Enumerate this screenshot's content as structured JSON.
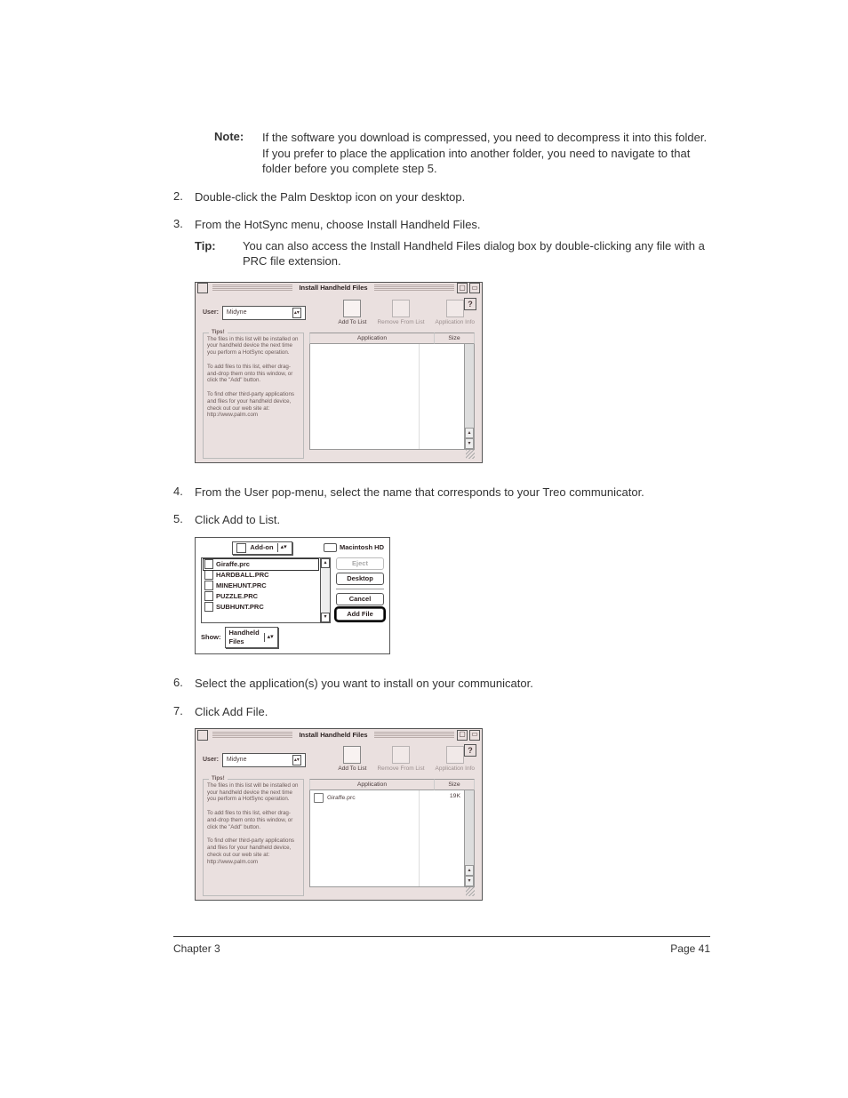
{
  "note": {
    "label": "Note:",
    "text": "If the software you download is compressed, you need to decompress it into this folder. If you prefer to place the application into another folder, you need to navigate to that folder before you complete step 5."
  },
  "steps": {
    "s2": {
      "num": "2.",
      "text": "Double-click the Palm Desktop icon on your desktop."
    },
    "s3": {
      "num": "3.",
      "text": "From the HotSync menu, choose Install Handheld Files."
    },
    "tip": {
      "label": "Tip:",
      "text": "You can also access the Install Handheld Files dialog box by double-clicking any file with a PRC file extension."
    },
    "s4": {
      "num": "4.",
      "text": "From the User pop-menu, select the name that corresponds to your Treo communicator."
    },
    "s5": {
      "num": "5.",
      "text": "Click Add to List."
    },
    "s6": {
      "num": "6.",
      "text": "Select the application(s) you want to install on your communicator."
    },
    "s7": {
      "num": "7.",
      "text": "Click Add File."
    }
  },
  "ihf": {
    "title": "Install Handheld Files",
    "help": "?",
    "user_label": "User:",
    "user_value": "Midyne",
    "toolbar": {
      "add": "Add To List",
      "remove": "Remove From List",
      "info": "Application Info"
    },
    "tips_title": "Tips!",
    "tip1": "The files in this list will be installed on your handheld device the next time you perform a HotSync operation.",
    "tip2": "To add files to this list, either drag-and-drop them onto this window, or click the \"Add\" button.",
    "tip3": "To find other third-party applications and files for your handheld device, check out our web site at: http://www.palm.com",
    "col_app": "Application",
    "col_size": "Size",
    "row1_app": "Giraffe.prc",
    "row1_size": "19K"
  },
  "picker": {
    "popup": "Add-on",
    "disk": "Macintosh HD",
    "files": {
      "f1": "Giraffe.prc",
      "f2": "HARDBALL.PRC",
      "f3": "MINEHUNT.PRC",
      "f4": "PUZZLE.PRC",
      "f5": "SUBHUNT.PRC"
    },
    "buttons": {
      "eject": "Eject",
      "desktop": "Desktop",
      "cancel": "Cancel",
      "addfile": "Add File"
    },
    "show_label": "Show:",
    "show_value": "Handheld Files"
  },
  "footer": {
    "left": "Chapter 3",
    "right": "Page 41"
  }
}
